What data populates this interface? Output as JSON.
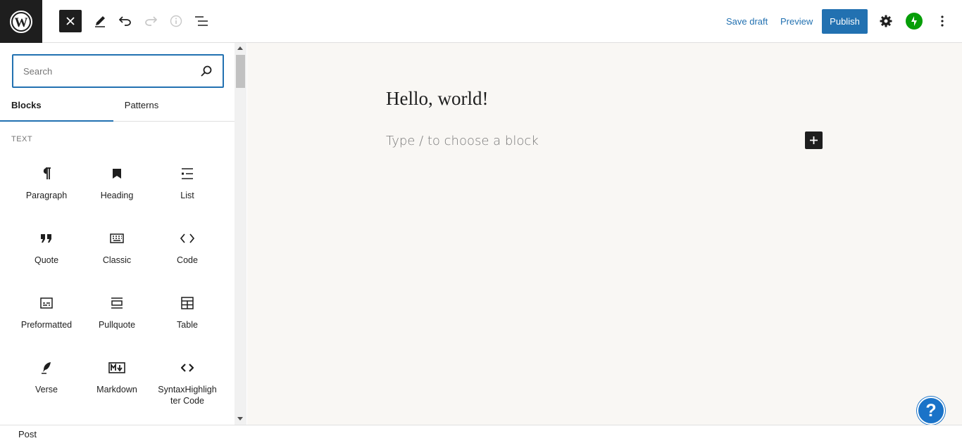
{
  "toolbar": {
    "save_draft": "Save draft",
    "preview": "Preview",
    "publish": "Publish"
  },
  "inserter": {
    "search_placeholder": "Search",
    "tabs": [
      "Blocks",
      "Patterns"
    ],
    "section_label": "TEXT",
    "blocks": [
      {
        "label": "Paragraph",
        "icon": "paragraph-icon"
      },
      {
        "label": "Heading",
        "icon": "heading-icon"
      },
      {
        "label": "List",
        "icon": "list-icon"
      },
      {
        "label": "Quote",
        "icon": "quote-icon"
      },
      {
        "label": "Classic",
        "icon": "classic-icon"
      },
      {
        "label": "Code",
        "icon": "code-icon"
      },
      {
        "label": "Preformatted",
        "icon": "preformatted-icon"
      },
      {
        "label": "Pullquote",
        "icon": "pullquote-icon"
      },
      {
        "label": "Table",
        "icon": "table-icon"
      },
      {
        "label": "Verse",
        "icon": "verse-icon"
      },
      {
        "label": "Markdown",
        "icon": "markdown-icon"
      },
      {
        "label": "SyntaxHighlighter Code",
        "icon": "syntaxhighlighter-icon"
      }
    ]
  },
  "editor": {
    "post_title": "Hello, world!",
    "block_placeholder": "Type / to choose a block"
  },
  "help": {
    "label": "?"
  },
  "footer": {
    "breadcrumb": "Post"
  },
  "colors": {
    "accent": "#2271b1",
    "canvas": "#f9f7f4",
    "jetpack": "#069e08",
    "help": "#1a73c8"
  }
}
